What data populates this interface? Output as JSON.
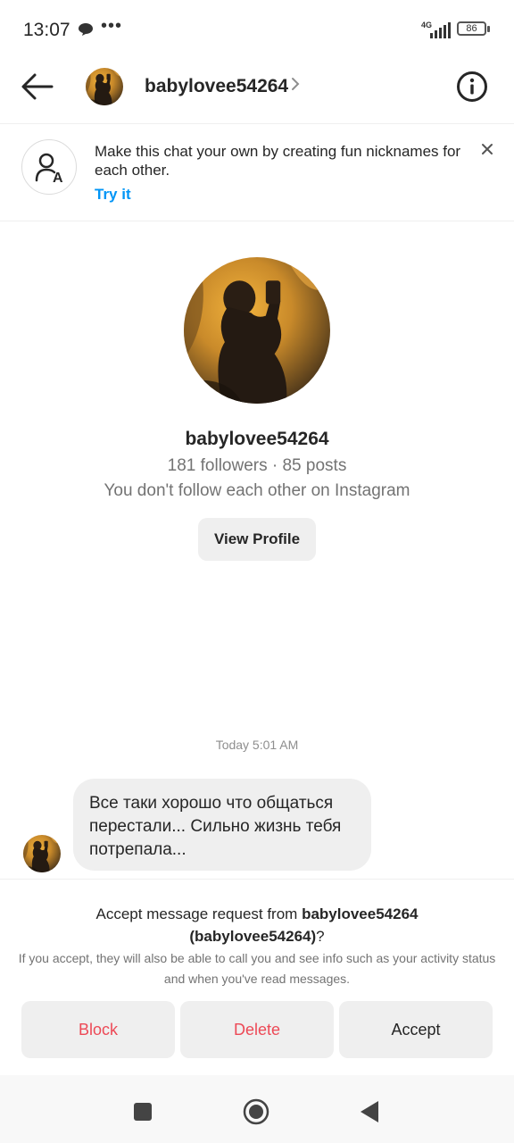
{
  "status": {
    "time": "13:07",
    "network": "4G",
    "battery": "86"
  },
  "header": {
    "username": "babylovee54264"
  },
  "banner": {
    "text": "Make this chat your own by creating fun nicknames for each other.",
    "link": "Try it"
  },
  "profile": {
    "username": "babylovee54264",
    "stats": "181 followers · 85 posts",
    "follow_status": "You don't follow each other on Instagram",
    "view_profile_label": "View Profile"
  },
  "messages": {
    "timestamp": "Today 5:01 AM",
    "text": "Все таки хорошо что общаться перестали... Сильно жизнь тебя потрепала..."
  },
  "request": {
    "title_prefix": "Accept message request from ",
    "title_username": "babylovee54264",
    "title_handle": "(babylovee54264)",
    "title_suffix": "?",
    "subtitle": "If you accept, they will also be able to call you and see info such as your activity status and when you've read messages.",
    "block_label": "Block",
    "delete_label": "Delete",
    "accept_label": "Accept"
  },
  "colors": {
    "link": "#0095f6",
    "destructive": "#ed4956",
    "secondary_text": "#737373",
    "button_bg": "#efefef"
  },
  "icons": {
    "back": "arrow-left-icon",
    "info": "info-circle-icon",
    "nickname": "person-nickname-icon",
    "close": "close-icon"
  }
}
